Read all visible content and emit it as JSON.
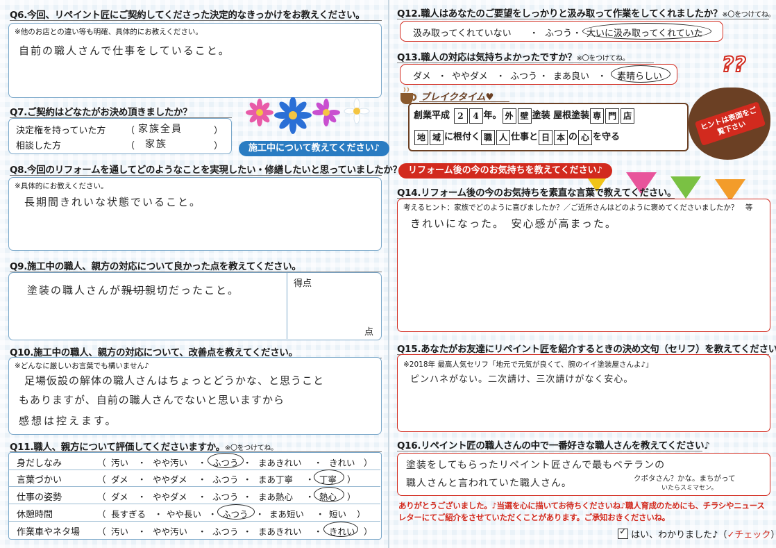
{
  "q6": {
    "question": "Q6.今回、リペイント匠にご契約してくださった決定的なきっかけをお教えください。",
    "hint": "※他のお店との違い等も明確、具体的にお教えください。",
    "answer": "自前の職人さんで仕事をしていること。"
  },
  "q7": {
    "question": "Q7.ご契約はどなたがお決め頂きましたか？",
    "rows": [
      {
        "label": "決定権を持っていた方",
        "open": "（",
        "answer": "家族全員",
        "close": "）"
      },
      {
        "label": "相談した方",
        "open": "（",
        "answer": "家族",
        "close": "）"
      }
    ]
  },
  "ribbon_blue": "施工中について教えてください♪",
  "q8": {
    "question": "Q8.今回のリフォームを通してどのようなことを実現したい・修繕したいと思っていましたか？",
    "hint": "※具体的にお教えください。",
    "answer": "長期間きれいな状態でいること。"
  },
  "q9": {
    "question": "Q9.施工中の職人、親方の対応について良かった点を教えてください。",
    "answer_pre": "塗装の職人さんが",
    "answer_struck": "親切",
    "answer_post": "親切だったこと。",
    "score_label": "得点",
    "score_unit": "点"
  },
  "q10": {
    "question": "Q10.施工中の職人、親方の対応について、改善点を教えてください。",
    "hint": "※どんなに厳しいお言葉でも構いません♪",
    "lines": [
      "足場仮設の解体の職人さんはちょっとどうかな、と思うこと",
      "もありますが、自前の職人さんでないと思いますから",
      "感想は控えます。"
    ]
  },
  "q11": {
    "question": "Q11.職人、親方について評価してくださいますか。",
    "note": "※〇をつけてね。",
    "rows": [
      {
        "label": "身だしなみ",
        "options": [
          "汚い",
          "やや汚い",
          "ふつう",
          "まあきれい",
          "きれい"
        ]
      },
      {
        "label": "言葉づかい",
        "options": [
          "ダメ",
          "ややダメ",
          "ふつう",
          "まあ丁寧",
          "丁寧"
        ]
      },
      {
        "label": "仕事の姿勢",
        "options": [
          "ダメ",
          "ややダメ",
          "ふつう",
          "まあ熱心",
          "熱心"
        ]
      },
      {
        "label": "休憩時間",
        "options": [
          "長すぎる",
          "やや長い",
          "ふつう",
          "まあ短い",
          "短い"
        ]
      },
      {
        "label": "作業車やネタ場",
        "options": [
          "汚い",
          "やや汚い",
          "ふつう",
          "まあきれい",
          "きれい"
        ]
      }
    ],
    "open": "（",
    "close": "）",
    "sep": "・"
  },
  "q12": {
    "question": "Q12.職人はあなたのご要望をしっかりと汲み取って作業をしてくれましたか？",
    "note": "※〇をつけてね。",
    "options": [
      "汲み取ってくれていない",
      "ふつう",
      "大いに汲み取ってくれていた"
    ]
  },
  "q13": {
    "question": "Q13.職人の対応は気持ちよかったですか？",
    "note": "※〇をつけてね。",
    "options": [
      "ダメ",
      "ややダメ",
      "ふつう",
      "まあ良い",
      "素晴らしい"
    ]
  },
  "break": {
    "title": "ブレイクタイム♥",
    "line1_pre": "創業平成",
    "line1_boxes": [
      "2",
      "4"
    ],
    "line1_mid": "年。",
    "line1_boxes2": [
      "外",
      "壁"
    ],
    "line1_post": "塗装 屋根塗装",
    "line1_boxes3": [
      "専",
      "門",
      "店"
    ],
    "line2_boxes1": [
      "地",
      "域"
    ],
    "line2_t1": "に根付く",
    "line2_boxes2": [
      "職",
      "人"
    ],
    "line2_t2": "仕事と",
    "line2_boxes3": [
      "日",
      "本"
    ],
    "line2_t3": "の",
    "line2_boxes4": [
      "心"
    ],
    "line2_t4": "を守る",
    "hint_badge": "ヒントは表面をご覧下さい",
    "qmarks": "??"
  },
  "ribbon_red": "リフォーム後の今のお気持ちを教えてください♪",
  "q14": {
    "question": "Q14.リフォーム後の今のお気持ちを素直な言葉で教えてください。",
    "hint": "考えるヒント：家族でどのように喜びましたか？／ご近所さんはどのように褒めてくださいましたか？　等",
    "answer": "きれいになった。　安心感が高まった。"
  },
  "q15": {
    "question": "Q15.あなたがお友達にリペイント匠を紹介するときの決め文句（セリフ）を教えてください♪",
    "hint": "※2018年 最高人気セリフ「地元で元気が良くて、腕のイイ塗装屋さんよ♪」",
    "answer": "ピンハネがない。二次請け、三次請けがなく安心。"
  },
  "q16": {
    "question": "Q16.リペイント匠の職人さんの中で一番好きな職人さんを教えてください♪",
    "line1": "塗装をしてもらったリペイント匠さんで最もベテランの",
    "line2": "職人さんと言われていた職人さん。",
    "line2_extra": "クボタさん？かな。まちがって",
    "line2_extra2": "いたらスミマセン。"
  },
  "thanks": [
    "ありがとうございました。♪当選を心に描いてお待ちくださいね♪職人育成のためにも、チラシやニュース",
    "レターにてご紹介をさせていただくことがあります。ご承知おきくださいね。"
  ],
  "confirm": {
    "label": "はい、わかりました♪（",
    "check": "✓チェック",
    "close": "）"
  },
  "colors": {
    "red": "#d22a1e",
    "blue": "#2a7cc2",
    "box_border": "#7aa7c9",
    "brown": "#6b4024"
  }
}
